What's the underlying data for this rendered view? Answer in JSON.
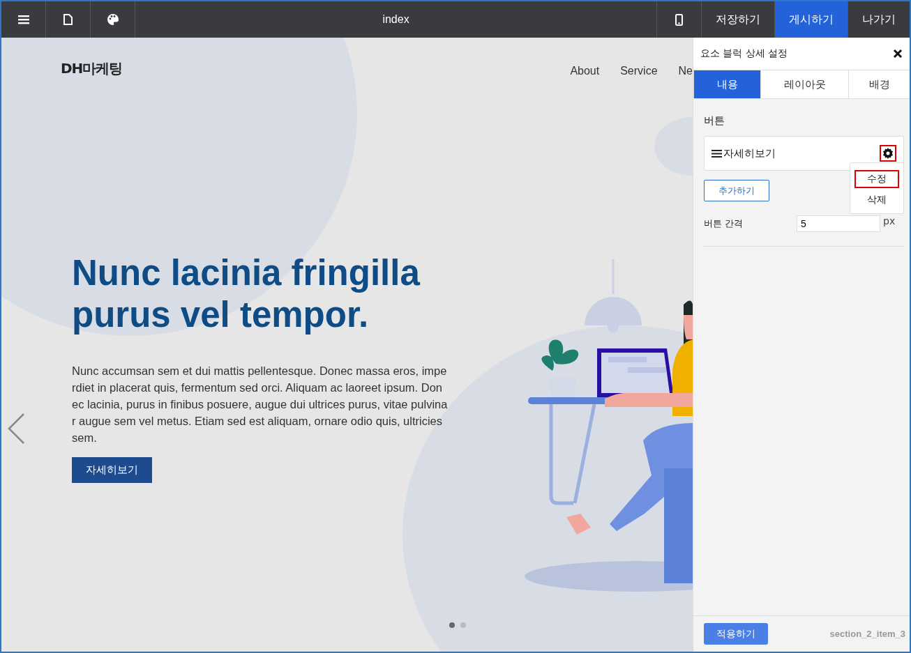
{
  "toolbar": {
    "title": "index",
    "actions": [
      {
        "label": "저장하기",
        "selected": false
      },
      {
        "label": "게시하기",
        "selected": true
      },
      {
        "label": "나가기",
        "selected": false
      }
    ]
  },
  "site": {
    "logo": "DH마케팅",
    "nav": [
      "About",
      "Service",
      "Ne"
    ]
  },
  "hero": {
    "title": "Nunc lacinia fringilla purus vel tempor.",
    "body": "Nunc accumsan sem et dui mattis pellentesque. Donec massa eros, imperdiet in placerat quis, fermentum sed orci. Aliquam ac laoreet ipsum. Donec lacinia, purus in finibus posuere, augue dui ultrices purus, vitae pulvinar augue sem vel metus. Etiam sed est aliquam, ornare odio quis, ultricies sem.",
    "button": "자세히보기",
    "dots": [
      {
        "selected": true
      },
      {
        "selected": false
      }
    ]
  },
  "panel": {
    "title": "요소 블럭 상세 설정",
    "tabs": [
      {
        "label": "내용",
        "selected": true
      },
      {
        "label": "레이아웃",
        "selected": false
      },
      {
        "label": "배경",
        "selected": false
      }
    ],
    "section_label": "버튼",
    "buttons": [
      {
        "label": "자세히보기"
      }
    ],
    "menu": {
      "items": [
        {
          "label": "수정",
          "highlighted": true
        },
        {
          "label": "삭제",
          "highlighted": false
        }
      ]
    },
    "add_button": "추가하기",
    "spacing": {
      "label": "버튼 간격",
      "value": "5",
      "unit": "px"
    },
    "apply_button": "적용하기",
    "element_id": "section_2_item_3"
  }
}
